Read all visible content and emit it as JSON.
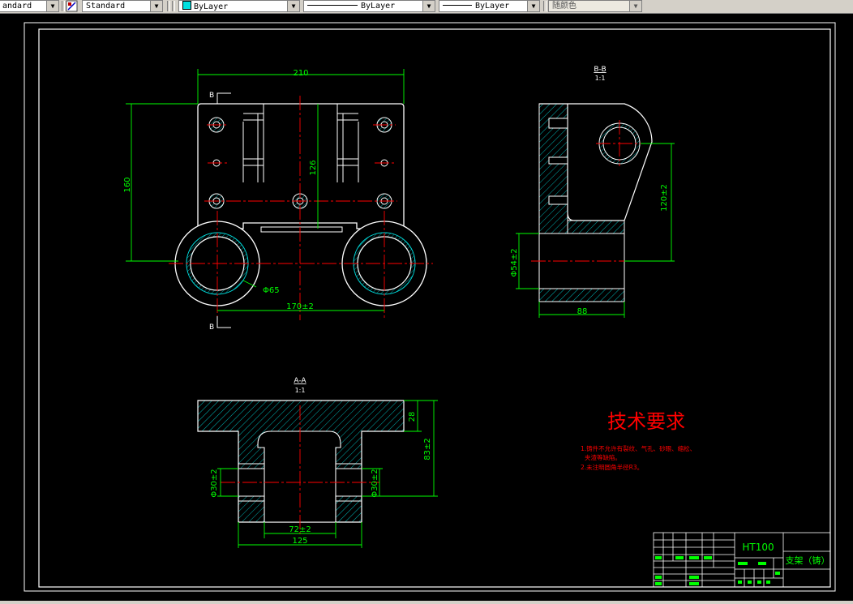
{
  "toolbar": {
    "textstyle_value": "andard",
    "dimstyle_value": "Standard",
    "layer_value": "ByLayer",
    "linetype_value": "ByLayer",
    "lineweight_value": "ByLayer",
    "color_value": "随颜色"
  },
  "drawing": {
    "top_view": {
      "width_dim": "210",
      "height_dim": "160",
      "inner_dim": "126",
      "bore_dim": "Φ65",
      "center_dim": "170±2",
      "section_mark_top": "B",
      "section_mark_bottom": "B"
    },
    "section_bb": {
      "title": "B-B",
      "scale": "1:1",
      "height_dim": "120±2",
      "bore_dim": "Φ54±2",
      "width_dim": "88"
    },
    "section_aa": {
      "title": "A-A",
      "scale": "1:1",
      "flange_dim": "28",
      "height_dim": "83±2",
      "left_dim": "Φ30±2",
      "right_dim": "Φ30±2",
      "inner_width_dim": "72±2",
      "base_width_dim": "125"
    },
    "tech_requirements": {
      "title": "技术要求",
      "line1": "1.铸件不允许有裂纹、气孔、砂眼、缩松、",
      "line2": "夹渣等缺陷。",
      "line3": "2.未注明圆角半径R3。"
    },
    "title_block": {
      "material": "HT100",
      "part_name": "支架（铸）"
    }
  },
  "colors": {
    "outline": "#ffffff",
    "dimension": "#00ff00",
    "centerline": "#ff0000",
    "hatch": "#00ffff",
    "text_red": "#ff0000"
  }
}
